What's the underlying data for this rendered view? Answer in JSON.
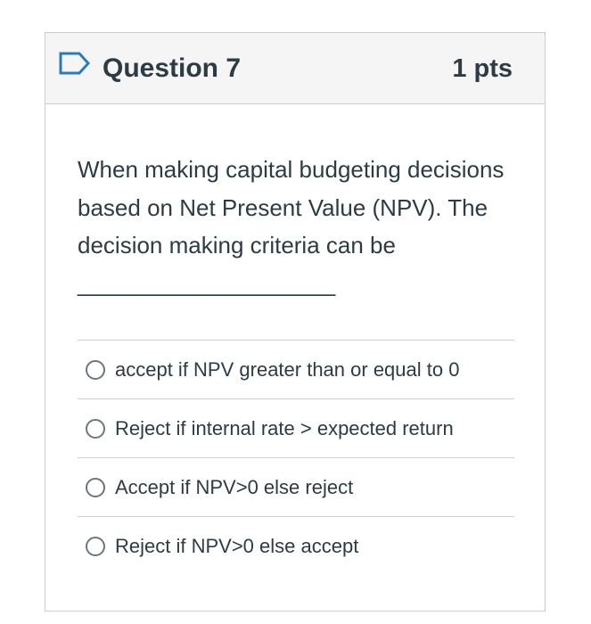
{
  "question": {
    "title": "Question 7",
    "points": "1 pts",
    "flag_icon": "flag-outline-icon",
    "text": "When making capital budgeting decisions based on Net Present Value (NPV). The decision making criteria can be ____________________"
  },
  "answers": [
    {
      "label": "accept if NPV greater than or equal to 0",
      "selected": false
    },
    {
      "label": "Reject if internal rate > expected return",
      "selected": false
    },
    {
      "label": "Accept if NPV>0 else reject",
      "selected": false
    },
    {
      "label": "Reject if NPV>0 else accept",
      "selected": false
    }
  ],
  "colors": {
    "header_bg": "#f5f5f5",
    "border": "#c7cdd1",
    "text": "#2d3b45",
    "flag_stroke": "#2b7abc"
  }
}
